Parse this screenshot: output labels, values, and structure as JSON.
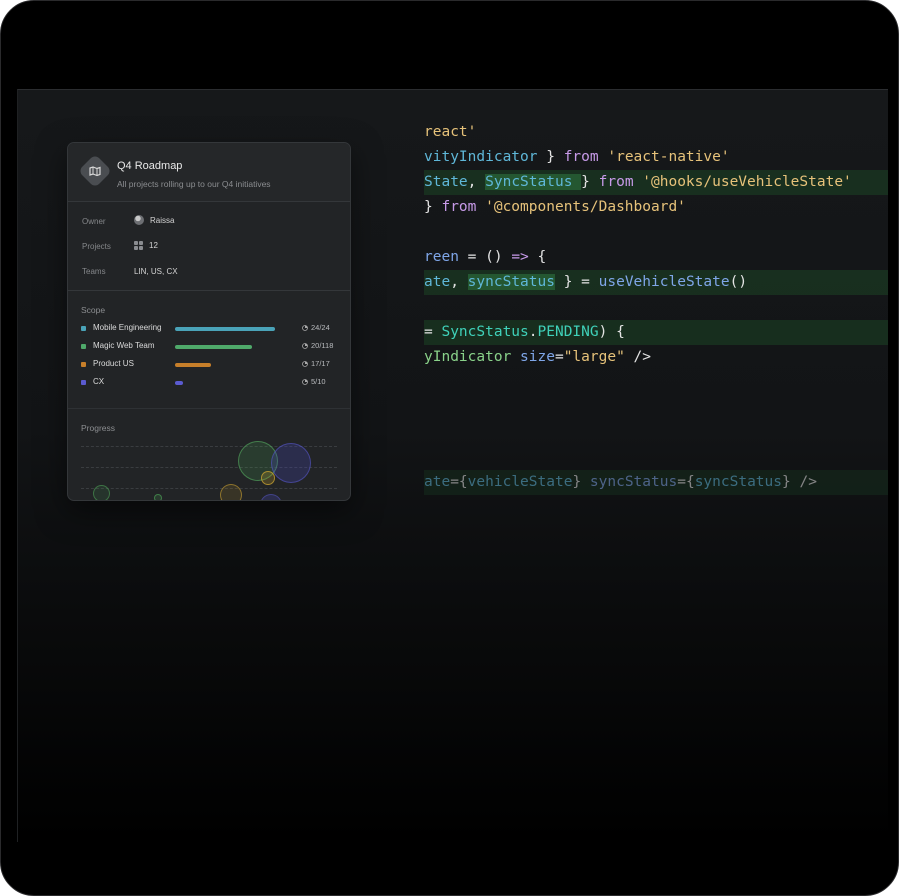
{
  "card": {
    "title": "Q4 Roadmap",
    "subtitle": "All projects rolling up to our Q4 initiatives",
    "icon": "roadmap-icon",
    "properties": [
      {
        "label": "Owner",
        "value": "Raissa",
        "icon": "avatar"
      },
      {
        "label": "Projects",
        "value": "12",
        "icon": "grid-icon"
      },
      {
        "label": "Teams",
        "value": "LIN, US, CX",
        "icon": ""
      }
    ],
    "scope": {
      "title": "Scope",
      "items": [
        {
          "name": "Mobile Engineering",
          "count": "24/24",
          "progress": 1.0,
          "color": "#4aa3b8"
        },
        {
          "name": "Magic Web Team",
          "count": "20/118",
          "progress": 0.77,
          "color": "#4fa96a"
        },
        {
          "name": "Product US",
          "count": "17/17",
          "progress": 0.36,
          "color": "#c77f2a"
        },
        {
          "name": "CX",
          "count": "5/10",
          "progress": 0.08,
          "color": "#5b5bd0"
        }
      ]
    },
    "progress": {
      "title": "Progress"
    }
  },
  "code": {
    "lines": [
      [
        {
          "t": "react'",
          "c": "t-str"
        }
      ],
      [
        {
          "t": "vityIndicator",
          "c": "t-id"
        },
        {
          "t": " } ",
          "c": "t-plain"
        },
        {
          "t": "from",
          "c": "t-kw"
        },
        {
          "t": " 'react-native'",
          "c": "t-str"
        }
      ],
      [
        {
          "t": "State",
          "c": "t-id"
        },
        {
          "t": ", ",
          "c": "t-plain"
        },
        {
          "t": "SyncStatus ",
          "c": "t-id t-mark"
        },
        {
          "t": "} ",
          "c": "t-plain"
        },
        {
          "t": "from",
          "c": "t-kw"
        },
        {
          "t": " '@hooks/useVehicleState'",
          "c": "t-str"
        }
      ],
      [
        {
          "t": "} ",
          "c": "t-plain"
        },
        {
          "t": "from",
          "c": "t-kw"
        },
        {
          "t": " '@components/Dashboard'",
          "c": "t-str"
        }
      ],
      [],
      [
        {
          "t": "reen",
          "c": "t-fn"
        },
        {
          "t": " = () ",
          "c": "t-plain"
        },
        {
          "t": "=>",
          "c": "t-kw"
        },
        {
          "t": " {",
          "c": "t-plain"
        }
      ],
      [
        {
          "t": "ate",
          "c": "t-id"
        },
        {
          "t": ", ",
          "c": "t-plain"
        },
        {
          "t": "syncStatus",
          "c": "t-id t-mark"
        },
        {
          "t": " } = ",
          "c": "t-plain"
        },
        {
          "t": "useVehicleState",
          "c": "t-fn"
        },
        {
          "t": "()",
          "c": "t-plain"
        }
      ],
      [],
      [
        {
          "t": "= ",
          "c": "t-plain"
        },
        {
          "t": "SyncStatus",
          "c": "t-cy"
        },
        {
          "t": ".",
          "c": "t-plain"
        },
        {
          "t": "PENDING",
          "c": "t-cy"
        },
        {
          "t": ") {",
          "c": "t-plain"
        }
      ],
      [
        {
          "t": "yIndicator",
          "c": "t-gr"
        },
        {
          "t": " size",
          "c": "t-fn"
        },
        {
          "t": "=",
          "c": "t-plain"
        },
        {
          "t": "\"large\"",
          "c": "t-str"
        },
        {
          "t": " />",
          "c": "t-plain"
        }
      ],
      [],
      [],
      [],
      [],
      [
        {
          "t": "ate",
          "c": "t-id"
        },
        {
          "t": "={",
          "c": "t-plain"
        },
        {
          "t": "vehicleState",
          "c": "t-id"
        },
        {
          "t": "} ",
          "c": "t-plain"
        },
        {
          "t": "syncStatus",
          "c": "t-fn"
        },
        {
          "t": "={",
          "c": "t-plain"
        },
        {
          "t": "syncStatus",
          "c": "t-id"
        },
        {
          "t": "} />",
          "c": "t-plain"
        }
      ]
    ],
    "highlighted": [
      2,
      6,
      8,
      14
    ],
    "faded": [
      14
    ]
  }
}
